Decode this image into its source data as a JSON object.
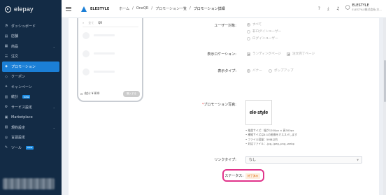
{
  "brand": {
    "name": "elepay"
  },
  "sidebar": {
    "items": [
      {
        "label": "ダッシュボード",
        "icon": "dashboard-icon",
        "glyph": "◔",
        "chevron": false,
        "badge": ""
      },
      {
        "label": "店舗",
        "icon": "store-icon",
        "glyph": "▤",
        "chevron": false,
        "badge": ""
      },
      {
        "label": "商品",
        "icon": "product-icon",
        "glyph": "▦",
        "chevron": true,
        "badge": ""
      },
      {
        "label": "注文",
        "icon": "order-icon",
        "glyph": "☰",
        "chevron": false,
        "badge": ""
      },
      {
        "label": "プロモーション",
        "icon": "promotion-icon",
        "glyph": "◈",
        "chevron": false,
        "badge": "",
        "active": true
      },
      {
        "label": "クーポン",
        "icon": "coupon-icon",
        "glyph": "◇",
        "chevron": false,
        "badge": ""
      },
      {
        "label": "キャンペーン",
        "icon": "campaign-icon",
        "glyph": "✦",
        "chevron": false,
        "badge": ""
      },
      {
        "label": "統計",
        "icon": "stats-icon",
        "glyph": "▥",
        "chevron": false,
        "badge": "new"
      },
      {
        "label": "サービス設定",
        "icon": "service-settings-icon",
        "glyph": "⚙",
        "chevron": true,
        "badge": ""
      },
      {
        "label": "Marketplace",
        "icon": "marketplace-icon",
        "glyph": "▣",
        "chevron": false,
        "badge": ""
      },
      {
        "label": "規約設定",
        "icon": "terms-icon",
        "glyph": "▧",
        "chevron": true,
        "badge": ""
      },
      {
        "label": "言語設定",
        "icon": "language-icon",
        "glyph": "◎",
        "chevron": false,
        "badge": ""
      },
      {
        "label": "ツール",
        "icon": "tool-icon",
        "glyph": "✎",
        "chevron": false,
        "badge": "new"
      }
    ]
  },
  "header": {
    "app_name": "ELESTYLE",
    "breadcrumb": [
      "ホーム",
      "OneQR",
      "プロモーション一覧",
      "プロモーション詳細"
    ],
    "user_name": "ELESTYLE",
    "user_company": "ELESTYLE株式会社(主..."
  },
  "phone": {
    "tab_all": "全て",
    "tab_qr": "QR",
    "price": "合計: ¥ 800",
    "button": "購入する"
  },
  "form": {
    "user_target_label": "ユーザー対象:",
    "user_target_options": [
      "すべて",
      "非ログインユーザー",
      "ログインユーザー"
    ],
    "display_location_label": "表示ロケーション:",
    "display_location_options": [
      "ランディングページ",
      "注文完了ページ"
    ],
    "display_type_label": "表示タイプ:",
    "display_type_options": [
      "バナー",
      "ポップアップ"
    ],
    "promo_image_label": "プロモーション写真:",
    "promo_image_required": "*",
    "promo_image_logo": "ele·style",
    "notes": [
      "• 推奨サイズ：幅が1200px × 高300px",
      "• 横縦サイズは4:1の画像をオススメします",
      "• ファイル容量：5MB以内",
      "• 対応ファイル：.jpg,.jpeg,.png,.webp"
    ],
    "link_type_label": "リンクタイプ:",
    "link_type_value": "なし",
    "status_label": "ステータス:",
    "status_value": "終了済み"
  },
  "colors": {
    "sidebar_bg": "#132b45",
    "accent": "#1b7fd6",
    "status_highlight": "#e0338a",
    "status_tag": "#e2741a"
  }
}
